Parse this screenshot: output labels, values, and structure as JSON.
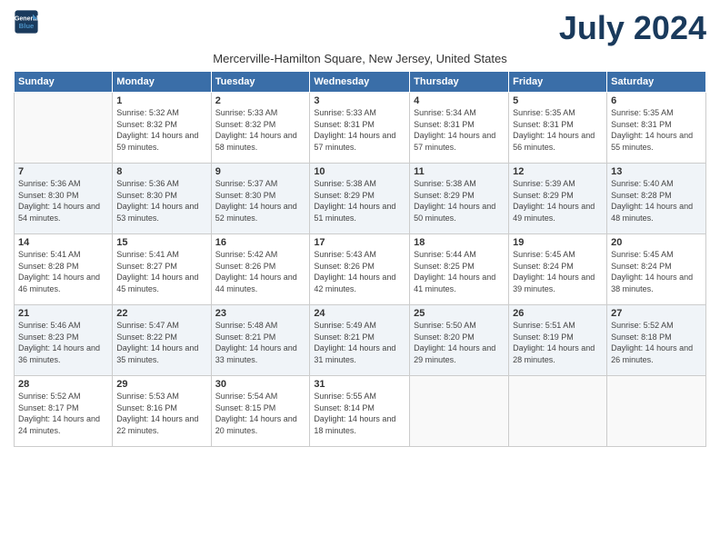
{
  "logo": {
    "line1": "General",
    "line2": "Blue",
    "icon_color": "#4a90c4"
  },
  "title": "July 2024",
  "subtitle": "Mercerville-Hamilton Square, New Jersey, United States",
  "headers": [
    "Sunday",
    "Monday",
    "Tuesday",
    "Wednesday",
    "Thursday",
    "Friday",
    "Saturday"
  ],
  "weeks": [
    [
      {
        "day": "",
        "sunrise": "",
        "sunset": "",
        "daylight": "",
        "empty": true
      },
      {
        "day": "1",
        "sunrise": "Sunrise: 5:32 AM",
        "sunset": "Sunset: 8:32 PM",
        "daylight": "Daylight: 14 hours and 59 minutes."
      },
      {
        "day": "2",
        "sunrise": "Sunrise: 5:33 AM",
        "sunset": "Sunset: 8:32 PM",
        "daylight": "Daylight: 14 hours and 58 minutes."
      },
      {
        "day": "3",
        "sunrise": "Sunrise: 5:33 AM",
        "sunset": "Sunset: 8:31 PM",
        "daylight": "Daylight: 14 hours and 57 minutes."
      },
      {
        "day": "4",
        "sunrise": "Sunrise: 5:34 AM",
        "sunset": "Sunset: 8:31 PM",
        "daylight": "Daylight: 14 hours and 57 minutes."
      },
      {
        "day": "5",
        "sunrise": "Sunrise: 5:35 AM",
        "sunset": "Sunset: 8:31 PM",
        "daylight": "Daylight: 14 hours and 56 minutes."
      },
      {
        "day": "6",
        "sunrise": "Sunrise: 5:35 AM",
        "sunset": "Sunset: 8:31 PM",
        "daylight": "Daylight: 14 hours and 55 minutes."
      }
    ],
    [
      {
        "day": "7",
        "sunrise": "Sunrise: 5:36 AM",
        "sunset": "Sunset: 8:30 PM",
        "daylight": "Daylight: 14 hours and 54 minutes."
      },
      {
        "day": "8",
        "sunrise": "Sunrise: 5:36 AM",
        "sunset": "Sunset: 8:30 PM",
        "daylight": "Daylight: 14 hours and 53 minutes."
      },
      {
        "day": "9",
        "sunrise": "Sunrise: 5:37 AM",
        "sunset": "Sunset: 8:30 PM",
        "daylight": "Daylight: 14 hours and 52 minutes."
      },
      {
        "day": "10",
        "sunrise": "Sunrise: 5:38 AM",
        "sunset": "Sunset: 8:29 PM",
        "daylight": "Daylight: 14 hours and 51 minutes."
      },
      {
        "day": "11",
        "sunrise": "Sunrise: 5:38 AM",
        "sunset": "Sunset: 8:29 PM",
        "daylight": "Daylight: 14 hours and 50 minutes."
      },
      {
        "day": "12",
        "sunrise": "Sunrise: 5:39 AM",
        "sunset": "Sunset: 8:29 PM",
        "daylight": "Daylight: 14 hours and 49 minutes."
      },
      {
        "day": "13",
        "sunrise": "Sunrise: 5:40 AM",
        "sunset": "Sunset: 8:28 PM",
        "daylight": "Daylight: 14 hours and 48 minutes."
      }
    ],
    [
      {
        "day": "14",
        "sunrise": "Sunrise: 5:41 AM",
        "sunset": "Sunset: 8:28 PM",
        "daylight": "Daylight: 14 hours and 46 minutes."
      },
      {
        "day": "15",
        "sunrise": "Sunrise: 5:41 AM",
        "sunset": "Sunset: 8:27 PM",
        "daylight": "Daylight: 14 hours and 45 minutes."
      },
      {
        "day": "16",
        "sunrise": "Sunrise: 5:42 AM",
        "sunset": "Sunset: 8:26 PM",
        "daylight": "Daylight: 14 hours and 44 minutes."
      },
      {
        "day": "17",
        "sunrise": "Sunrise: 5:43 AM",
        "sunset": "Sunset: 8:26 PM",
        "daylight": "Daylight: 14 hours and 42 minutes."
      },
      {
        "day": "18",
        "sunrise": "Sunrise: 5:44 AM",
        "sunset": "Sunset: 8:25 PM",
        "daylight": "Daylight: 14 hours and 41 minutes."
      },
      {
        "day": "19",
        "sunrise": "Sunrise: 5:45 AM",
        "sunset": "Sunset: 8:24 PM",
        "daylight": "Daylight: 14 hours and 39 minutes."
      },
      {
        "day": "20",
        "sunrise": "Sunrise: 5:45 AM",
        "sunset": "Sunset: 8:24 PM",
        "daylight": "Daylight: 14 hours and 38 minutes."
      }
    ],
    [
      {
        "day": "21",
        "sunrise": "Sunrise: 5:46 AM",
        "sunset": "Sunset: 8:23 PM",
        "daylight": "Daylight: 14 hours and 36 minutes."
      },
      {
        "day": "22",
        "sunrise": "Sunrise: 5:47 AM",
        "sunset": "Sunset: 8:22 PM",
        "daylight": "Daylight: 14 hours and 35 minutes."
      },
      {
        "day": "23",
        "sunrise": "Sunrise: 5:48 AM",
        "sunset": "Sunset: 8:21 PM",
        "daylight": "Daylight: 14 hours and 33 minutes."
      },
      {
        "day": "24",
        "sunrise": "Sunrise: 5:49 AM",
        "sunset": "Sunset: 8:21 PM",
        "daylight": "Daylight: 14 hours and 31 minutes."
      },
      {
        "day": "25",
        "sunrise": "Sunrise: 5:50 AM",
        "sunset": "Sunset: 8:20 PM",
        "daylight": "Daylight: 14 hours and 29 minutes."
      },
      {
        "day": "26",
        "sunrise": "Sunrise: 5:51 AM",
        "sunset": "Sunset: 8:19 PM",
        "daylight": "Daylight: 14 hours and 28 minutes."
      },
      {
        "day": "27",
        "sunrise": "Sunrise: 5:52 AM",
        "sunset": "Sunset: 8:18 PM",
        "daylight": "Daylight: 14 hours and 26 minutes."
      }
    ],
    [
      {
        "day": "28",
        "sunrise": "Sunrise: 5:52 AM",
        "sunset": "Sunset: 8:17 PM",
        "daylight": "Daylight: 14 hours and 24 minutes."
      },
      {
        "day": "29",
        "sunrise": "Sunrise: 5:53 AM",
        "sunset": "Sunset: 8:16 PM",
        "daylight": "Daylight: 14 hours and 22 minutes."
      },
      {
        "day": "30",
        "sunrise": "Sunrise: 5:54 AM",
        "sunset": "Sunset: 8:15 PM",
        "daylight": "Daylight: 14 hours and 20 minutes."
      },
      {
        "day": "31",
        "sunrise": "Sunrise: 5:55 AM",
        "sunset": "Sunset: 8:14 PM",
        "daylight": "Daylight: 14 hours and 18 minutes."
      },
      {
        "day": "",
        "sunrise": "",
        "sunset": "",
        "daylight": "",
        "empty": true
      },
      {
        "day": "",
        "sunrise": "",
        "sunset": "",
        "daylight": "",
        "empty": true
      },
      {
        "day": "",
        "sunrise": "",
        "sunset": "",
        "daylight": "",
        "empty": true
      }
    ]
  ]
}
